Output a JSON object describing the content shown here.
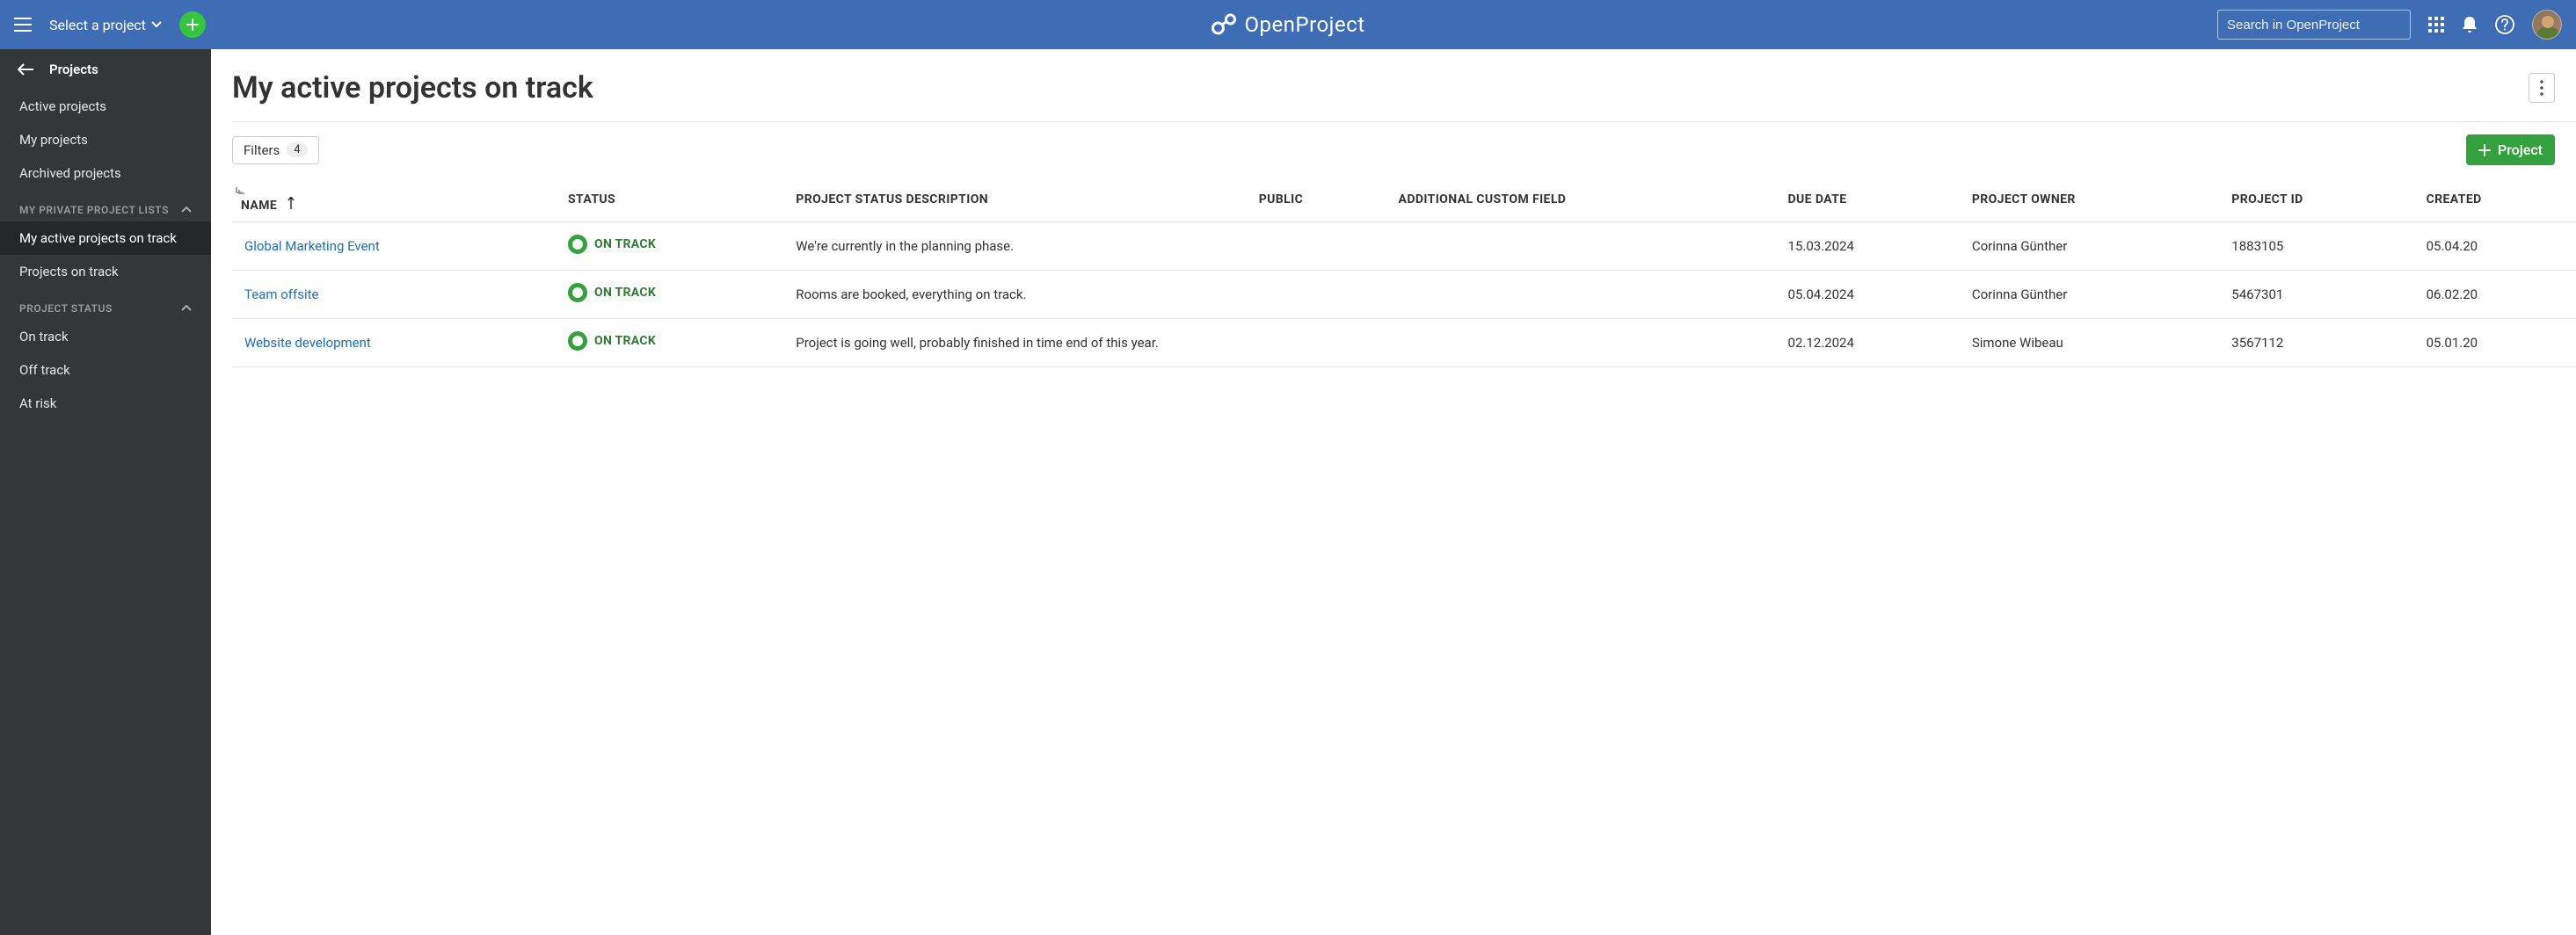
{
  "colors": {
    "topbar": "#3f6db5",
    "green": "#35a03e",
    "sidebar": "#333739"
  },
  "topbar": {
    "project_selector": "Select a project",
    "brand": "OpenProject",
    "search_placeholder": "Search in OpenProject"
  },
  "sidebar": {
    "back_label": "Projects",
    "main_items": [
      {
        "label": "Active projects"
      },
      {
        "label": "My projects"
      },
      {
        "label": "Archived projects"
      }
    ],
    "private_header": "MY PRIVATE PROJECT LISTS",
    "private_items": [
      {
        "label": "My active projects on track",
        "active": true
      },
      {
        "label": "Projects on track"
      }
    ],
    "status_header": "PROJECT STATUS",
    "status_items": [
      {
        "label": "On track"
      },
      {
        "label": "Off track"
      },
      {
        "label": "At risk"
      }
    ]
  },
  "main": {
    "title": "My active projects on track",
    "filters_label": "Filters",
    "filters_count": "4",
    "create_button": "Project",
    "columns": {
      "name": "NAME",
      "status": "STATUS",
      "description": "PROJECT STATUS DESCRIPTION",
      "public": "PUBLIC",
      "custom": "ADDITIONAL CUSTOM FIELD",
      "due": "DUE DATE",
      "owner": "PROJECT OWNER",
      "pid": "PROJECT ID",
      "created": "CREATED"
    },
    "rows": [
      {
        "name": "Global Marketing Event",
        "status": "ON TRACK",
        "description": "We're currently in the planning phase.",
        "public": "",
        "custom": "",
        "due": "15.03.2024",
        "owner": "Corinna Günther",
        "pid": "1883105",
        "created": "05.04.20"
      },
      {
        "name": "Team offsite",
        "status": "ON TRACK",
        "description": "Rooms are booked, everything on track.",
        "public": "",
        "custom": "",
        "due": "05.04.2024",
        "owner": "Corinna Günther",
        "pid": "5467301",
        "created": "06.02.20"
      },
      {
        "name": "Website development",
        "status": "ON TRACK",
        "description": "Project is going well, probably finished in time end of this year.",
        "public": "",
        "custom": "",
        "due": "02.12.2024",
        "owner": "Simone Wibeau",
        "pid": "3567112",
        "created": "05.01.20"
      }
    ]
  }
}
